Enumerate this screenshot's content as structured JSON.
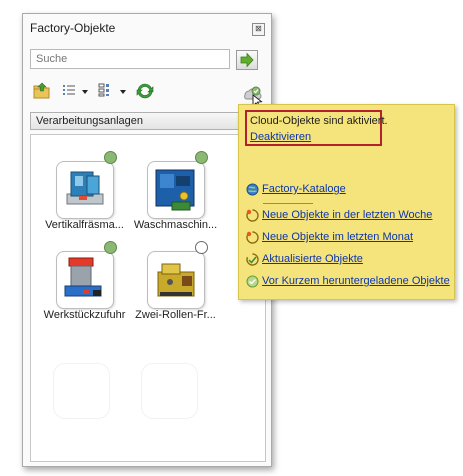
{
  "panel": {
    "title": "Factory-Objekte",
    "close_glyph": "⊠",
    "search": {
      "placeholder": "Suche"
    },
    "toolbar_icons": [
      "folder-up-icon",
      "list-view-icon",
      "grid-view-icon",
      "refresh-icon",
      "cloud-status-icon"
    ],
    "category": "Verarbeitungsanlagen"
  },
  "items": [
    {
      "label": "Vertikalfräsma...",
      "status": "synced",
      "icon": "vertical-mill-icon"
    },
    {
      "label": "Waschmaschin...",
      "status": "synced",
      "icon": "washing-machine-icon"
    },
    {
      "label": "Werkstückzufuhr",
      "status": "synced",
      "icon": "workpiece-feeder-icon"
    },
    {
      "label": "Zwei-Rollen-Fr...",
      "status": "not-downloaded",
      "icon": "two-roll-mill-icon"
    }
  ],
  "popup": {
    "cloud_message": "Cloud-Objekte sind aktiviert.",
    "deactivate": "Deaktivieren",
    "links": [
      {
        "label": "Factory-Kataloge",
        "icon": "globe-icon"
      },
      {
        "label": "Neue Objekte in der letzten Woche",
        "icon": "new-object-icon"
      },
      {
        "label": "Neue Objekte im letzten Monat",
        "icon": "new-object-icon"
      },
      {
        "label": "Aktualisierte Objekte",
        "icon": "updated-object-icon"
      },
      {
        "label": "Vor Kurzem heruntergeladene Objekte",
        "icon": "checkmark-icon"
      }
    ]
  },
  "colors": {
    "popup_bg": "#f5e47b",
    "link": "#0e35a8",
    "highlight_border": "#b5202e",
    "status_ok": "#8bb874"
  }
}
